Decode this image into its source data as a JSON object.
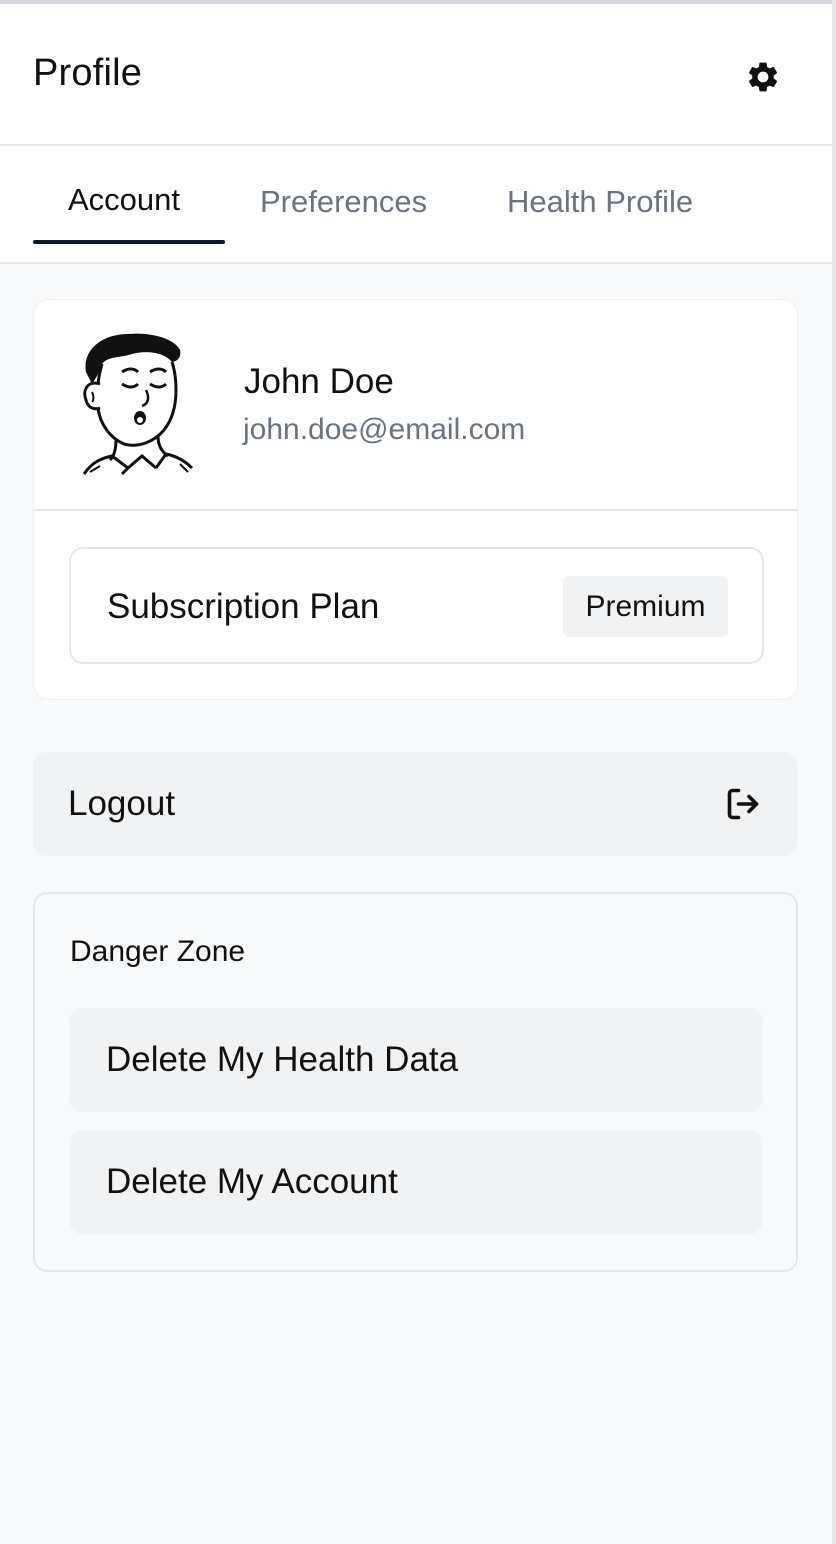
{
  "header": {
    "title": "Profile",
    "settings_icon": "gear-icon"
  },
  "tabs": [
    {
      "label": "Account",
      "active": true
    },
    {
      "label": "Preferences",
      "active": false
    },
    {
      "label": "Health Profile",
      "active": false
    }
  ],
  "profile": {
    "name": "John Doe",
    "email": "john.doe@email.com",
    "avatar": "avatar-illustration"
  },
  "subscription": {
    "label": "Subscription Plan",
    "plan": "Premium"
  },
  "logout": {
    "label": "Logout",
    "icon": "logout-icon"
  },
  "danger_zone": {
    "title": "Danger Zone",
    "actions": [
      {
        "label": "Delete My Health Data"
      },
      {
        "label": "Delete My Account"
      }
    ]
  },
  "colors": {
    "background": "#f8f9fb",
    "card": "#ffffff",
    "muted_text": "#6b7280",
    "tab_indicator": "#111827",
    "button_bg": "#f1f2f4",
    "border": "#e5e7eb"
  }
}
